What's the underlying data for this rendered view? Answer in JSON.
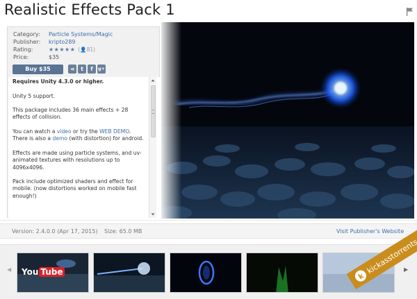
{
  "title": "Realistic Effects Pack 1",
  "meta": {
    "category_label": "Category:",
    "category_value": "Particle Systems/Magic",
    "publisher_label": "Publisher:",
    "publisher_value": "kripto289",
    "rating_label": "Rating:",
    "rating_stars": "★★★★★",
    "rating_stars_value": 5,
    "rating_count": "(👤81)",
    "price_label": "Price:",
    "price_value": "$35"
  },
  "buy_button": "Buy $35",
  "share_buttons": [
    {
      "icon": "share-icon",
      "glyph": "⋖"
    },
    {
      "icon": "twitter-icon",
      "glyph": "t"
    },
    {
      "icon": "facebook-icon",
      "glyph": "f"
    },
    {
      "icon": "googleplus-icon",
      "glyph": "g+"
    }
  ],
  "description": {
    "p1_bold": "Requires Unity 4.3.0 or higher.",
    "p2": "Unity 5 support.",
    "p3": "This package includes 36 main effects + 28 effects of collision.",
    "p4_pre": "You can watch a ",
    "p4_link1": "video",
    "p4_mid": " or try the ",
    "p4_link2": "WEB DEMO",
    "p4_post": ".",
    "p4b_pre": "There is also a ",
    "p4b_link": "demo",
    "p4b_post": " (with distortion) for android.",
    "p5": "Effects are made using particle systems, and uv-animated textures with resolutions up to 4096x4096.",
    "p6": "Pack include optimized shaders and effect for mobile. (now distortions worked on mobile fast enough!)"
  },
  "version_bar": {
    "version": "Version: 2.4.0.0 (Apr 17, 2015)",
    "size": "Size: 65.0 MB",
    "publisher_link": "Visit Publisher's Website"
  },
  "thumbnails": [
    {
      "name": "thumb-youtube",
      "label": "You",
      "label2": "Tube"
    },
    {
      "name": "thumb-beam"
    },
    {
      "name": "thumb-portal"
    },
    {
      "name": "thumb-green"
    },
    {
      "name": "thumb-blue"
    }
  ],
  "watermark": {
    "text": "kickasstorrents"
  },
  "colors": {
    "link": "#3d6ca8",
    "buy_button": "#5a7494",
    "hero_glow": "#2a6bff"
  }
}
